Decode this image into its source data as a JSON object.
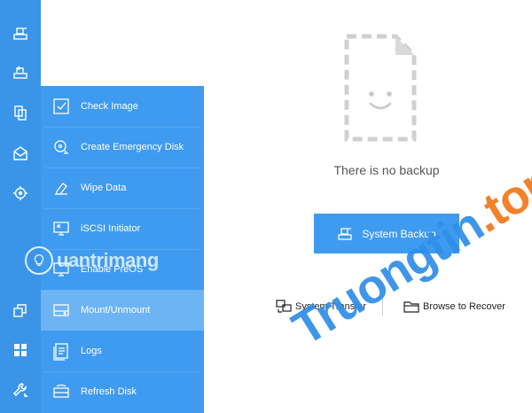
{
  "rail": {
    "items": [
      {
        "name": "backup-icon"
      },
      {
        "name": "restore-icon"
      },
      {
        "name": "clone-icon"
      },
      {
        "name": "email-icon"
      },
      {
        "name": "target-icon"
      },
      {
        "name": "window-restore-icon"
      },
      {
        "name": "apps-grid-icon"
      },
      {
        "name": "tools-wrench-icon"
      }
    ]
  },
  "menu": {
    "items": [
      {
        "label": "Check Image",
        "icon": "check-image-icon"
      },
      {
        "label": "Create Emergency Disk",
        "icon": "emergency-disk-icon"
      },
      {
        "label": "Wipe Data",
        "icon": "eraser-icon"
      },
      {
        "label": "iSCSI Initiator",
        "icon": "monitor-arrow-icon"
      },
      {
        "label": "Enable PreOS",
        "icon": "preos-icon"
      },
      {
        "label": "Mount/Unmount",
        "icon": "drive-icon"
      },
      {
        "label": "Logs",
        "icon": "logs-icon"
      },
      {
        "label": "Refresh Disk",
        "icon": "refresh-disk-icon"
      }
    ],
    "active_index": 5
  },
  "main": {
    "empty_text": "There is no backup",
    "backup_button": "System Backup",
    "system_transfer": "System Transfer",
    "browse_to_recover": "Browse to Recover"
  },
  "watermarks": {
    "left": "uantrimang",
    "right_main": "Truongtin",
    "right_dot": ".",
    "right_tail": "top"
  },
  "colors": {
    "rail": "#3a95e9",
    "flyout": "#3f9bf0",
    "active": "#6db4f5",
    "accent": "#3f9bf0"
  }
}
